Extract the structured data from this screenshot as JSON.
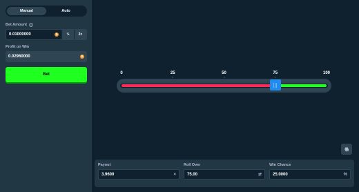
{
  "sidebar": {
    "tabs": [
      {
        "label": "Manual",
        "active": true
      },
      {
        "label": "Auto",
        "active": false
      }
    ],
    "bet_amount": {
      "label": "Bet Amount",
      "value": "0.01000000",
      "currency_icon": "btc-coin-icon",
      "half_label": "½",
      "double_label": "2×"
    },
    "profit": {
      "label": "Profit on Win",
      "value": "0.02960000",
      "currency_icon": "btc-coin-icon"
    },
    "bet_button": {
      "label": "Bet",
      "color": "#1fff20"
    }
  },
  "slider": {
    "ticks": [
      "0",
      "25",
      "50",
      "75",
      "100"
    ],
    "roll_over_value": 75,
    "min": 0,
    "max": 100,
    "lose_color": "#ff2956",
    "win_color": "#1fff20",
    "handle_color": "#1e8cf0"
  },
  "stats": {
    "payout": {
      "label": "Payout",
      "value": "3.9600",
      "suffix": "×"
    },
    "roll_over": {
      "label": "Roll Over",
      "value": "75.00",
      "suffix": "⇄"
    },
    "win_chance": {
      "label": "Win Chance",
      "value": "25.0000",
      "suffix": "%"
    }
  },
  "settings_icon": "gear-icon"
}
